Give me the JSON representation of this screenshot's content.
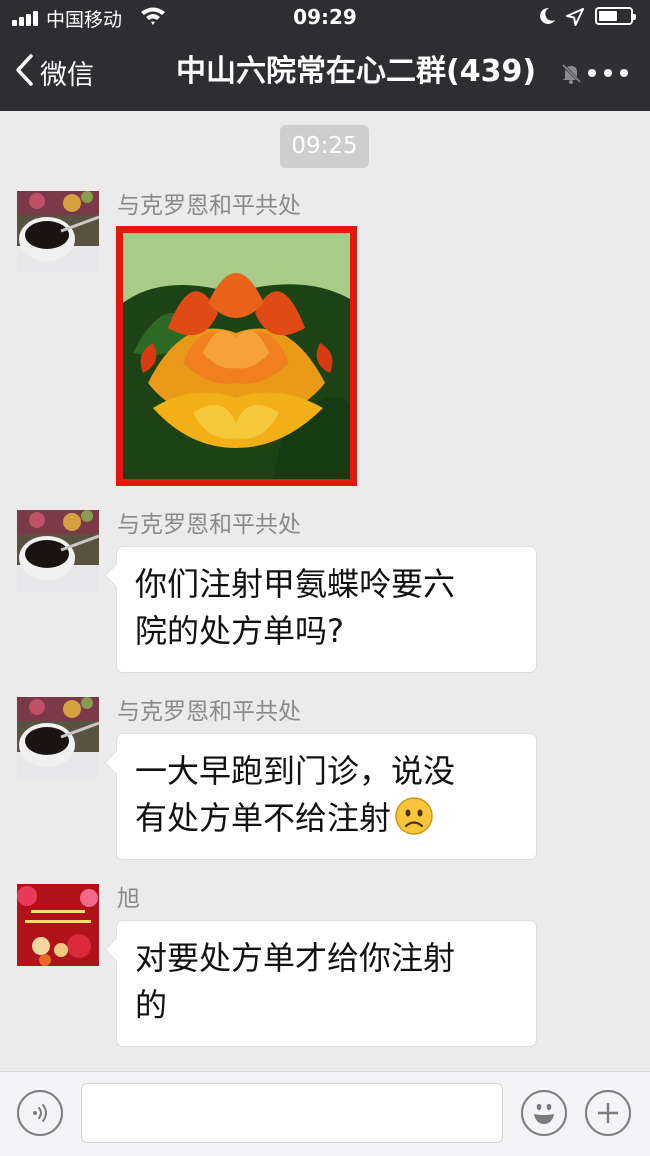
{
  "status_bar": {
    "carrier": "中国移动",
    "time": "09:29"
  },
  "nav": {
    "back_label": "微信",
    "title": "中山六院常在心二群(439)"
  },
  "chat": {
    "timestamp": "09:25",
    "messages": [
      {
        "sender": "与克罗恩和平共处",
        "type": "image"
      },
      {
        "sender": "与克罗恩和平共处",
        "type": "text",
        "lines": [
          "你们注射甲氨蝶呤要六",
          "院的处方单吗?"
        ]
      },
      {
        "sender": "与克罗恩和平共处",
        "type": "text",
        "lines": [
          "一大早跑到门诊，说没",
          "有处方单不给注射"
        ],
        "emoji": "frowning-face-emoji"
      },
      {
        "sender": "旭",
        "type": "text",
        "lines": [
          "对要处方单才给你注射",
          "的"
        ]
      }
    ]
  },
  "input_bar": {
    "text_value": ""
  },
  "icons": {
    "back": "chevron-left-icon",
    "mute": "muted-bell-icon",
    "more": "more-dots-icon",
    "voice": "voice-icon",
    "emoji": "emoji-icon",
    "plus": "plus-icon"
  },
  "colors": {
    "nav_bg": "#2e2e32",
    "chat_bg": "#ebebeb",
    "image_border": "#e2170e"
  }
}
